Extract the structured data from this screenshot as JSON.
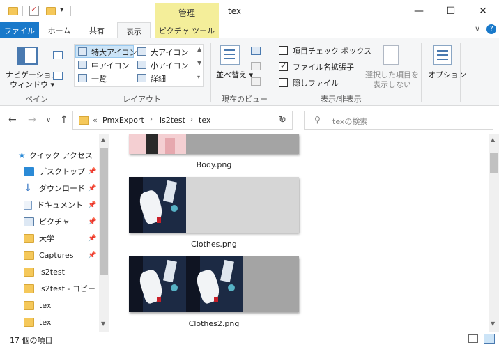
{
  "title_bar": {
    "context_tab": "管理",
    "window_title": "tex",
    "minimize": "—",
    "maximize": "☐",
    "close": "✕"
  },
  "ribbon_tabs": {
    "file": "ファイル",
    "home": "ホーム",
    "share": "共有",
    "view": "表示",
    "picture_tools": "ピクチャ ツール"
  },
  "ribbon": {
    "pane": {
      "nav_pane_line1": "ナビゲーション",
      "nav_pane_line2": "ウィンドウ",
      "label": "ペイン"
    },
    "layout": {
      "items": [
        "特大アイコン",
        "大アイコン",
        "中アイコン",
        "小アイコン",
        "一覧",
        "詳細"
      ],
      "label": "レイアウト"
    },
    "current_view": {
      "sort": "並べ替え",
      "label": "現在のビュー"
    },
    "show_hide": {
      "item_checkbox": "項目チェック ボックス",
      "file_ext": "ファイル名拡張子",
      "hidden": "隠しファイル",
      "hide_selected_line1": "選択した項目を",
      "hide_selected_line2": "表示しない",
      "label": "表示/非表示"
    },
    "options": "オプション",
    "checkbox_states": {
      "item_checkbox": false,
      "file_ext": true,
      "hidden": false
    }
  },
  "address": {
    "crumbs": [
      "PmxExport",
      "ls2test",
      "tex"
    ],
    "search_placeholder": "texの検索"
  },
  "nav_pane": {
    "quick_access": "クイック アクセス",
    "items": [
      {
        "label": "デスクトップ",
        "pinned": true
      },
      {
        "label": "ダウンロード",
        "pinned": true
      },
      {
        "label": "ドキュメント",
        "pinned": true
      },
      {
        "label": "ピクチャ",
        "pinned": true
      },
      {
        "label": "大学",
        "pinned": true
      },
      {
        "label": "Captures",
        "pinned": true
      },
      {
        "label": "ls2test",
        "pinned": false
      },
      {
        "label": "ls2test - コピー",
        "pinned": false
      },
      {
        "label": "tex",
        "pinned": false
      },
      {
        "label": "tex",
        "pinned": false
      }
    ]
  },
  "files": [
    {
      "name": "Body.png"
    },
    {
      "name": "Clothes.png"
    },
    {
      "name": "Clothes2.png"
    }
  ],
  "status": {
    "count": "17 個の項目"
  }
}
